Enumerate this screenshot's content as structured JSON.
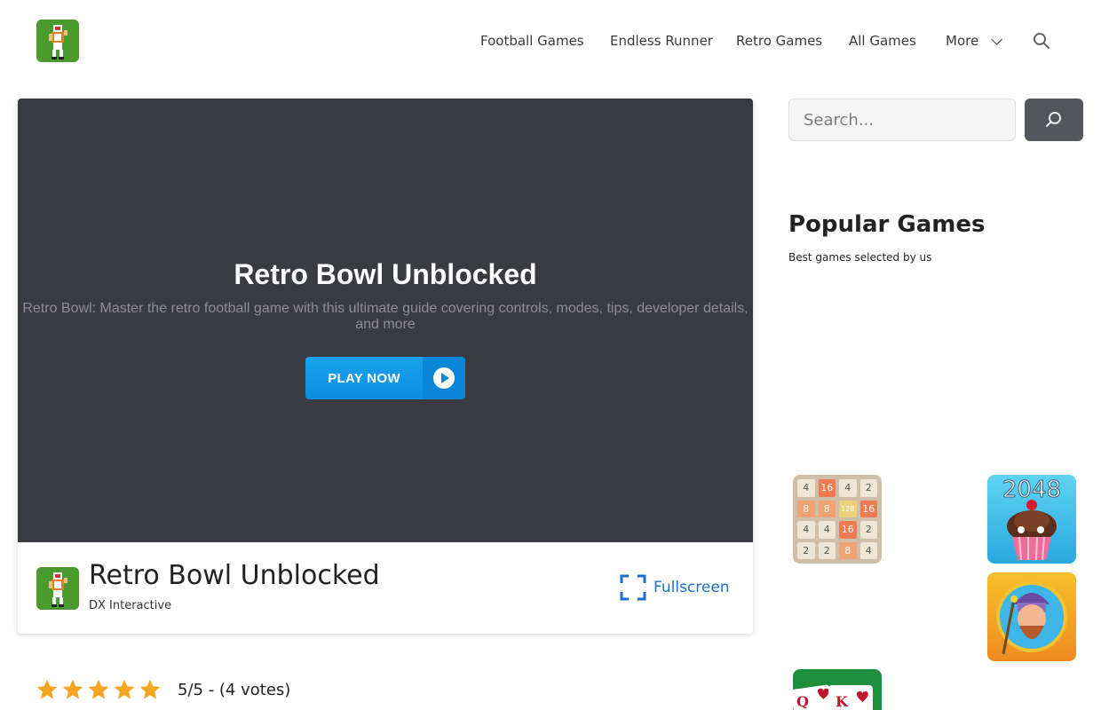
{
  "header": {
    "logo_alt": "Retro Bowl logo",
    "nav": [
      {
        "label": "Football Games"
      },
      {
        "label": "Endless Runner"
      },
      {
        "label": "Retro Games"
      },
      {
        "label": "All Games"
      },
      {
        "label": "More"
      }
    ]
  },
  "hero": {
    "title": "Retro Bowl Unblocked",
    "description": "Retro Bowl: Master the retro football game with this ultimate guide covering controls, modes, tips, developer details, and more",
    "play_label": "PLAY NOW"
  },
  "game_info": {
    "title": "Retro Bowl Unblocked",
    "developer": "DX Interactive",
    "fullscreen_label": "Fullscreen"
  },
  "rating": {
    "stars": 5,
    "text": "5/5 - (4 votes)",
    "star_color": "#f5a623"
  },
  "sidebar": {
    "search_placeholder": "Search...",
    "popular_title": "Popular Games",
    "popular_subtitle": "Best games selected by us",
    "thumb_2048_tiles": [
      "4",
      "16",
      "4",
      "2",
      "8",
      "8",
      "128",
      "16",
      "4",
      "4",
      "16",
      "2",
      "2",
      "2",
      "8",
      "4"
    ],
    "thumb_cake_label": "2048"
  },
  "colors": {
    "hero_bg": "#3a3b41",
    "play_button": "#0c8ee0",
    "link": "#1a6fd1",
    "logo_bg": "#4a9a2e"
  }
}
